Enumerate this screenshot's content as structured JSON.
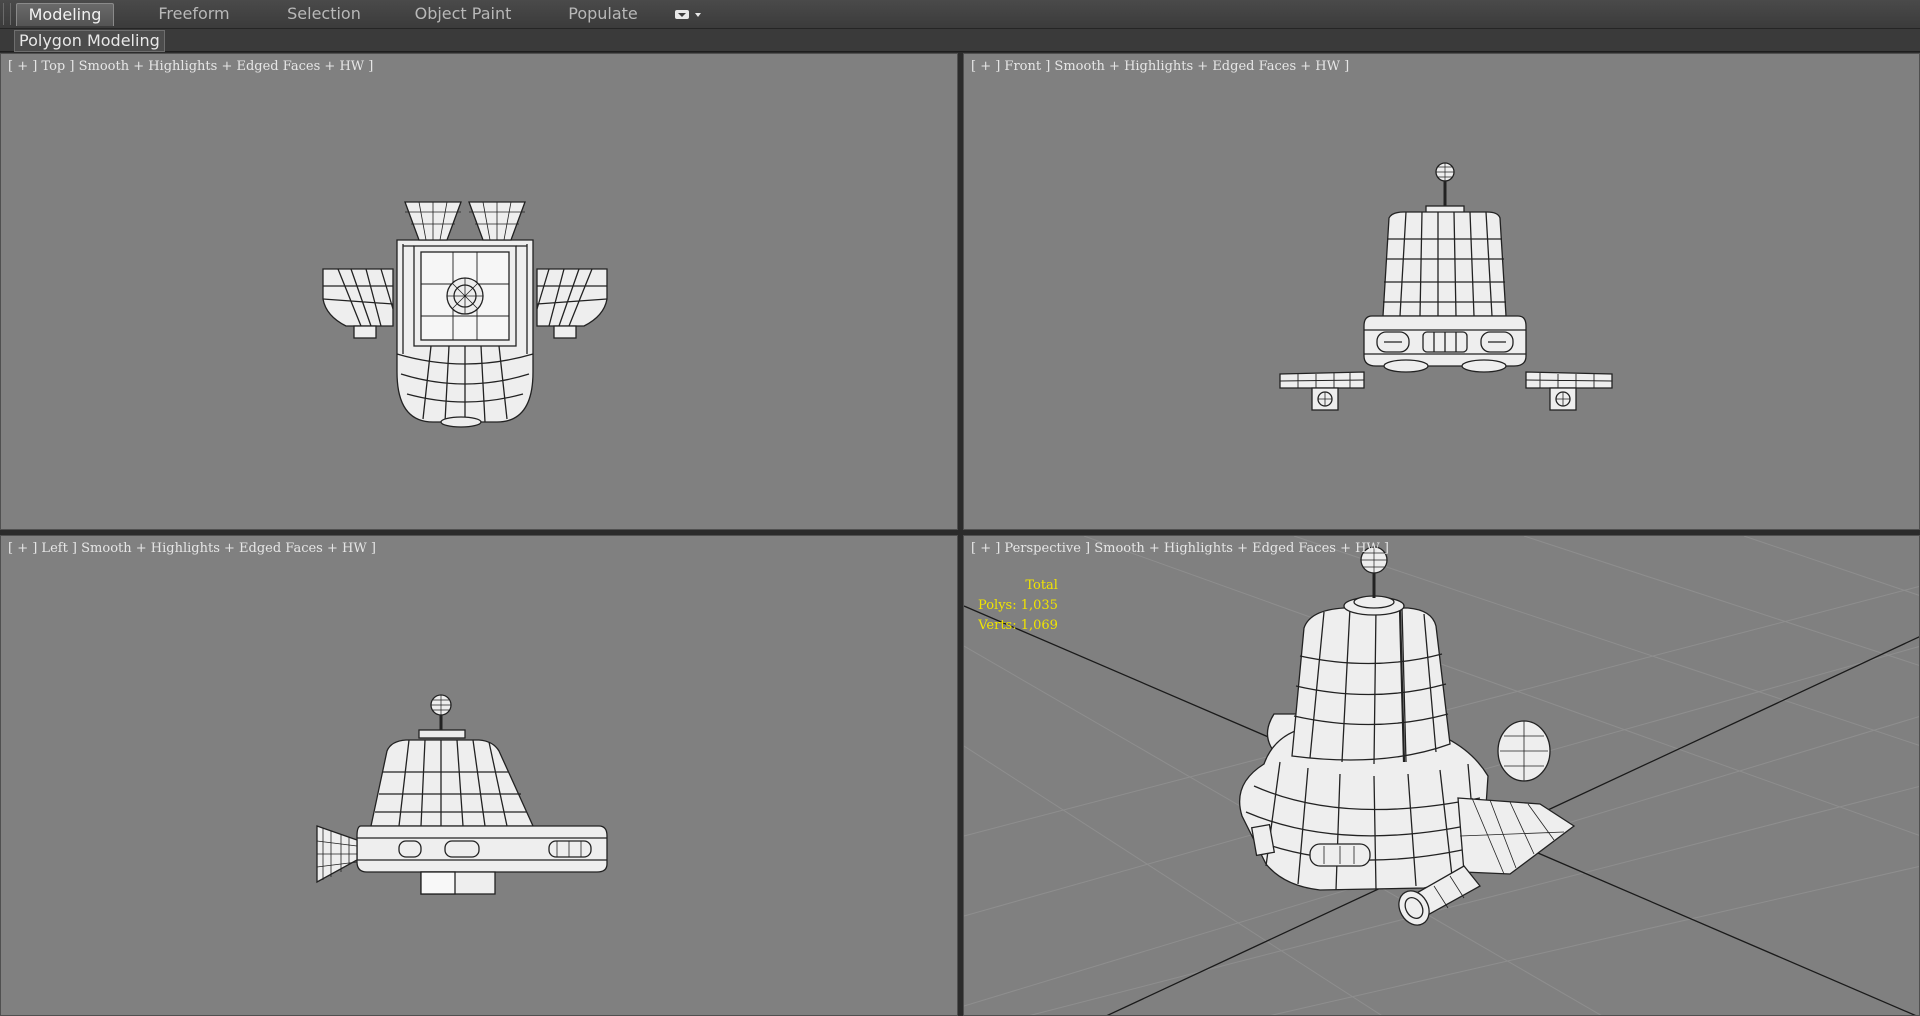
{
  "ribbon": {
    "tabs": [
      {
        "label": "Modeling",
        "active": true
      },
      {
        "label": "Freeform",
        "active": false
      },
      {
        "label": "Selection",
        "active": false
      },
      {
        "label": "Object Paint",
        "active": false
      },
      {
        "label": "Populate",
        "active": false
      }
    ],
    "panel_label": "Polygon Modeling",
    "colors": {
      "active_tab": "#5e5e5e",
      "tab_text": "#b8b8b8",
      "viewport_bg": "#808080"
    }
  },
  "viewports": {
    "top": {
      "label": "[ + ] Top ] Smooth + Highlights + Edged Faces + HW ]"
    },
    "front": {
      "label": "[ + ] Front ] Smooth + Highlights + Edged Faces + HW ]"
    },
    "left": {
      "label": "[ + ] Left ] Smooth + Highlights + Edged Faces + HW ]"
    },
    "perspective": {
      "label": "[ + ] Perspective ] Smooth + Highlights + Edged Faces + HW ]"
    }
  },
  "stats": {
    "total_label": "Total",
    "polys_label": "Polys: 1,035",
    "verts_label": "Verts: 1,069",
    "color": "#f0e400"
  }
}
